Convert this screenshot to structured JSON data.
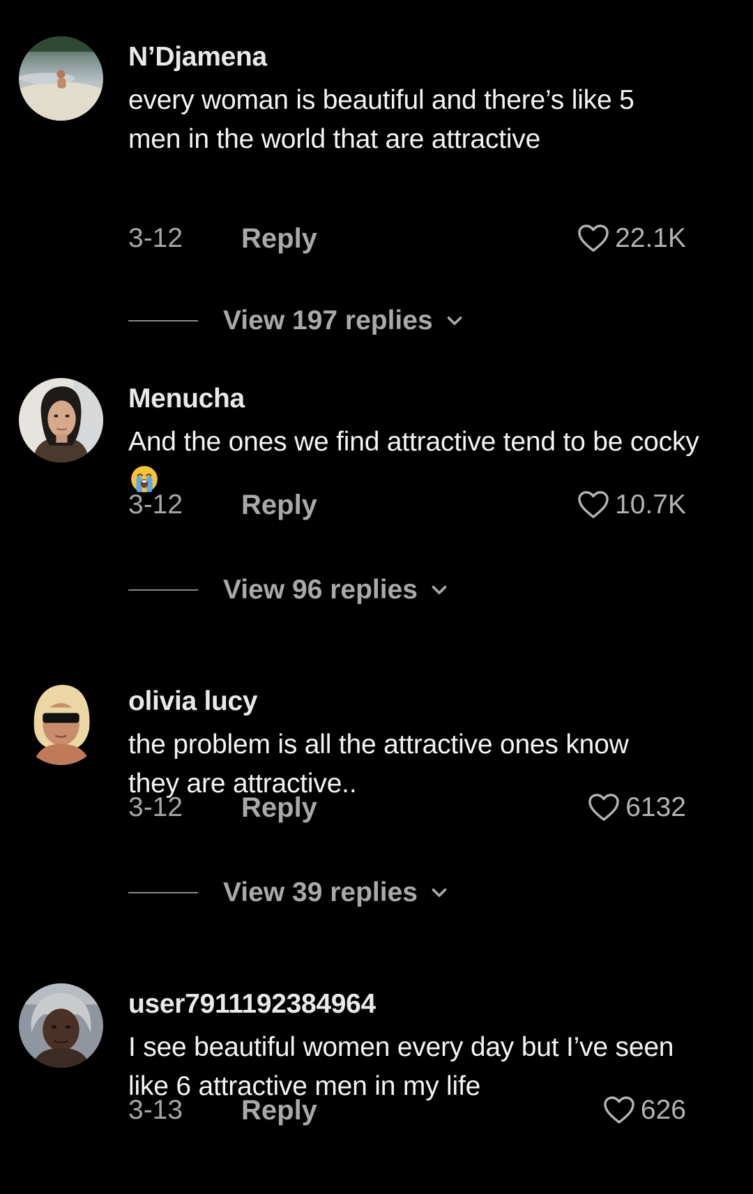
{
  "comments": [
    {
      "username": "N’Djamena",
      "text": "every woman is beautiful and there’s like 5 men in the world that are attractive",
      "date": "3-12",
      "reply_label": "Reply",
      "likes": "22.1K",
      "view_replies": "View 197 replies",
      "avatar": "beach-photo"
    },
    {
      "username": "Menucha",
      "text": "And the ones we find attractive tend to be cocky",
      "emoji": "loudly-crying-face-emoji",
      "date": "3-12",
      "reply_label": "Reply",
      "likes": "10.7K",
      "view_replies": "View 96 replies",
      "avatar": "woman-portrait"
    },
    {
      "username": "olivia lucy",
      "text": "the problem is all the attractive ones know they are attractive..",
      "date": "3-12",
      "reply_label": "Reply",
      "likes": "6132",
      "view_replies": "View 39 replies",
      "avatar": "blonde-sunglasses-portrait"
    },
    {
      "username": "user7911192384964",
      "text": "I see beautiful women every day but I’ve seen like 6 attractive men in my life",
      "date": "3-13",
      "reply_label": "Reply",
      "likes": "626",
      "avatar": "gray-hair-portrait"
    }
  ],
  "colors": {
    "background": "#000000",
    "primary_text": "#f4f4f4",
    "secondary_text": "#a9a9a9"
  }
}
